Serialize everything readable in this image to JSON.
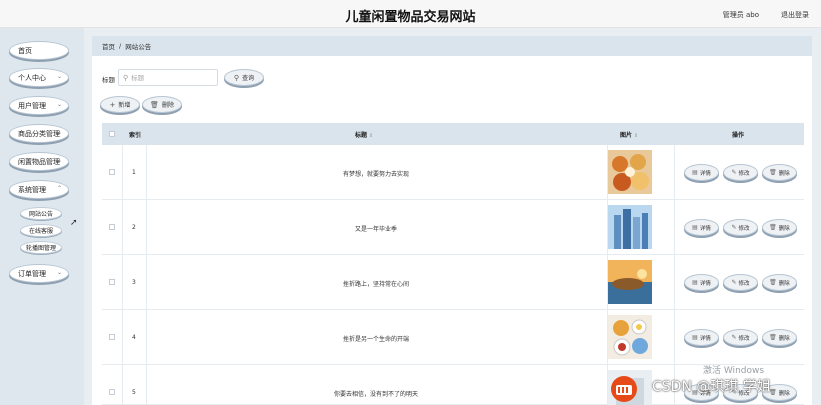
{
  "header": {
    "title": "儿童闲置物品交易网站",
    "user": "管理员 abo",
    "logout": "退出登录"
  },
  "sidebar": {
    "items": [
      {
        "label": "首页"
      },
      {
        "label": "个人中心"
      },
      {
        "label": "用户管理"
      },
      {
        "label": "商品分类管理"
      },
      {
        "label": "闲置物品管理"
      },
      {
        "label": "系统管理"
      },
      {
        "label": "订单管理"
      }
    ],
    "sub_items": [
      {
        "label": "网站公告"
      },
      {
        "label": "在线客服"
      },
      {
        "label": "轮播图管理"
      }
    ]
  },
  "breadcrumb": {
    "home": "首页",
    "sep": "/",
    "current": "网站公告"
  },
  "search": {
    "label": "标题",
    "placeholder": "标题",
    "button": "查询"
  },
  "toolbar": {
    "add": "新增",
    "delete": "删除"
  },
  "table": {
    "headers": {
      "index": "索引",
      "title": "标题",
      "image": "图片",
      "actions": "操作"
    },
    "rows": [
      {
        "index": "1",
        "title": "有梦想，就要努力去实现",
        "image": "food-bowls-image"
      },
      {
        "index": "2",
        "title": "又是一年毕业季",
        "image": "blue-buildings-image"
      },
      {
        "index": "3",
        "title": "挫折路上，坚持常在心间",
        "image": "sunset-beach-image"
      },
      {
        "index": "4",
        "title": "挫折是另一个生命的开端",
        "image": "breakfast-table-image"
      },
      {
        "index": "5",
        "title": "你要去相信，没有到不了的明天",
        "image": "partial-image"
      }
    ],
    "actions": {
      "detail": "详情",
      "edit": "修改",
      "delete": "删除"
    }
  },
  "overlay": {
    "windows": "激活 Windows",
    "csdn": "CSDN @琪琪 学姐"
  }
}
